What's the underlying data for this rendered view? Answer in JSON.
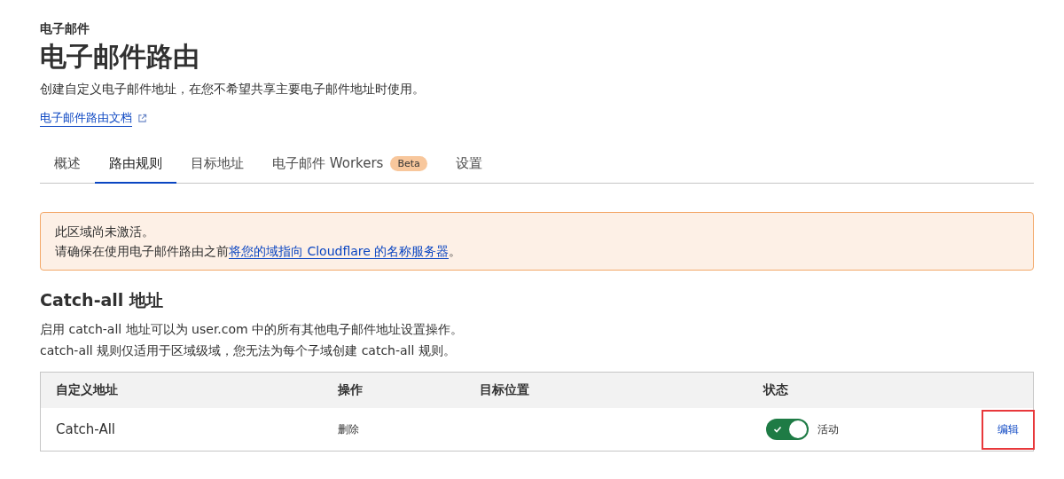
{
  "breadcrumb": "电子邮件",
  "title": "电子邮件路由",
  "description": "创建自定义电子邮件地址，在您不希望共享主要电子邮件地址时使用。",
  "docs_link": "电子邮件路由文档",
  "tabs": [
    {
      "label": "概述",
      "selected": false
    },
    {
      "label": "路由规则",
      "selected": true
    },
    {
      "label": "目标地址",
      "selected": false
    },
    {
      "label": "电子邮件 Workers",
      "selected": false,
      "badge": "Beta"
    },
    {
      "label": "设置",
      "selected": false
    }
  ],
  "alert": {
    "line_1": "此区域尚未激活。",
    "line_2_prefix": "请确保在使用电子邮件路由之前",
    "line_2_link": "将您的域指向 Cloudflare 的名称服务器",
    "line_2_suffix": "。"
  },
  "section": {
    "title": "Catch-all 地址",
    "lines": [
      "启用 catch-all 地址可以为 user.com 中的所有其他电子邮件地址设置操作。",
      "catch-all 规则仅适用于区域级域，您无法为每个子域创建 catch-all 规则。"
    ]
  },
  "table": {
    "columns": [
      "自定义地址",
      "操作",
      "目标位置",
      "状态"
    ],
    "rows": [
      {
        "address": "Catch-All",
        "action": "删除",
        "status_on": true,
        "status_label": "活动",
        "edit": "编辑",
        "highlighted": true
      }
    ]
  }
}
